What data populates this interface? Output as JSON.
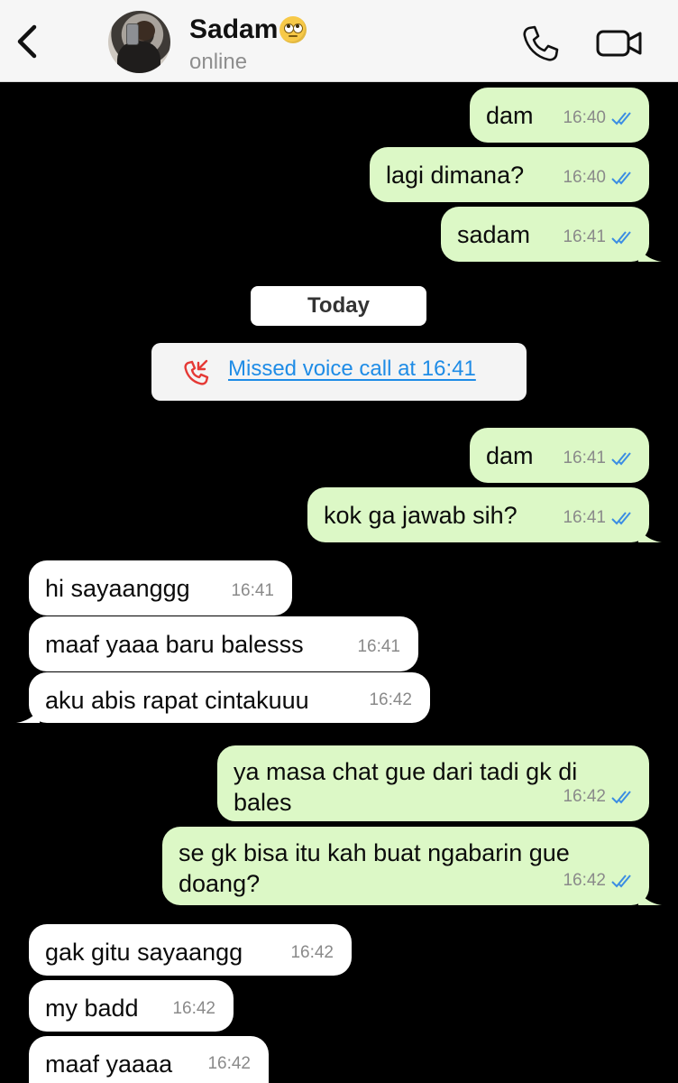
{
  "header": {
    "contact_name": "Sadam",
    "status": "online",
    "emoji": "face-with-rolling-eyes"
  },
  "date_separator": "Today",
  "missed_call": "Missed voice call at 16:41",
  "messages": [
    {
      "dir": "out",
      "text": "dam",
      "time": "16:40"
    },
    {
      "dir": "out",
      "text": "lagi dimana?",
      "time": "16:40"
    },
    {
      "dir": "out",
      "text": "sadam",
      "time": "16:41"
    },
    {
      "dir": "out",
      "text": "dam",
      "time": "16:41"
    },
    {
      "dir": "out",
      "text": "kok ga jawab sih?",
      "time": "16:41"
    },
    {
      "dir": "in",
      "text": "hi sayaanggg",
      "time": "16:41"
    },
    {
      "dir": "in",
      "text": "maaf yaaa baru balesss",
      "time": "16:41"
    },
    {
      "dir": "in",
      "text": "aku abis rapat cintakuuu",
      "time": "16:42"
    },
    {
      "dir": "out",
      "text": "ya masa chat gue dari tadi gk di",
      "text2": "bales",
      "time": "16:42"
    },
    {
      "dir": "out",
      "text": "se gk bisa itu kah buat ngabarin gue",
      "text2": "doang?",
      "time": "16:42"
    },
    {
      "dir": "in",
      "text": "gak gitu sayaangg",
      "time": "16:42"
    },
    {
      "dir": "in",
      "text": "my badd",
      "time": "16:42"
    },
    {
      "dir": "in",
      "text": "maaf yaaaa",
      "time": "16:42"
    }
  ],
  "colors": {
    "outgoing_bubble": "#dcf8c6",
    "incoming_bubble": "#ffffff",
    "read_tick": "#3b8de3",
    "missed_call_red": "#e53935",
    "link_blue": "#1f8ce6",
    "background": "#000000"
  }
}
